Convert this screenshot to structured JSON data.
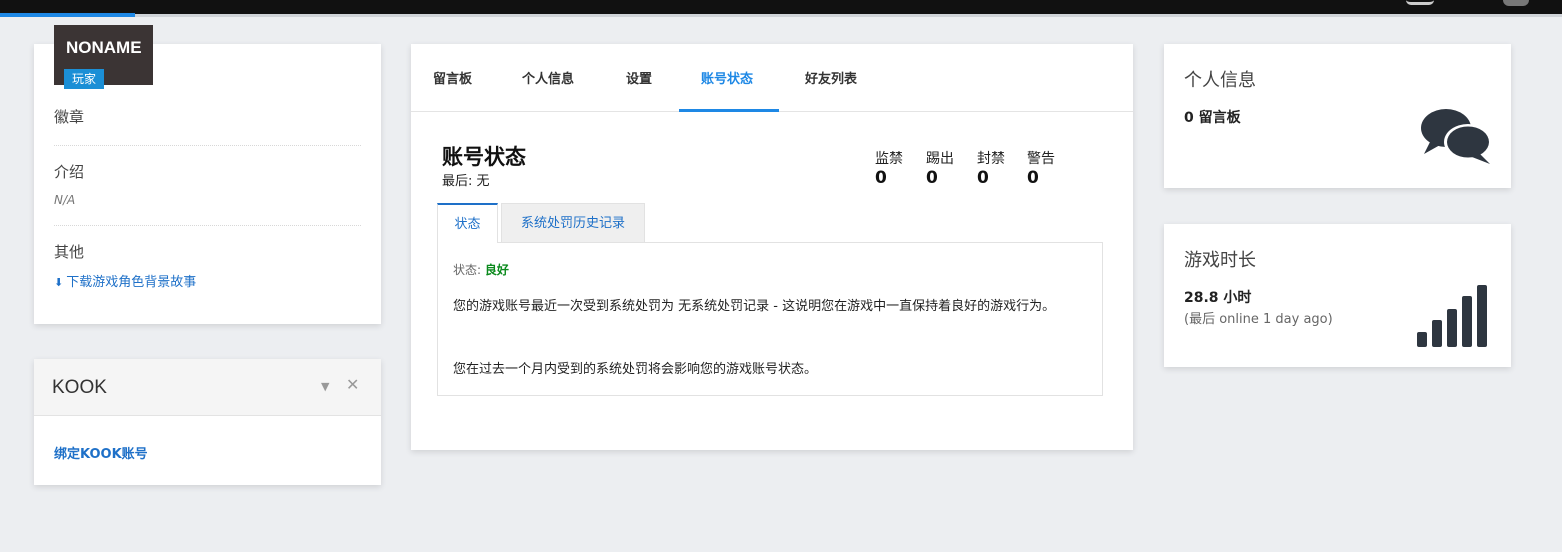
{
  "profile": {
    "name": "NONAME",
    "role": "玩家",
    "badges_label": "徽章",
    "intro_label": "介绍",
    "intro_value": "N/A",
    "other_label": "其他",
    "download_link": "下载游戏角色背景故事"
  },
  "kook": {
    "title": "KOOK",
    "bind_link": "绑定KOOK账号"
  },
  "nav": {
    "tabs": [
      "留言板",
      "个人信息",
      "设置",
      "账号状态",
      "好友列表"
    ],
    "active": "账号状态"
  },
  "account": {
    "title": "账号状态",
    "last": "最后: 无",
    "stats": [
      {
        "label": "监禁",
        "value": "0"
      },
      {
        "label": "踢出",
        "value": "0"
      },
      {
        "label": "封禁",
        "value": "0"
      },
      {
        "label": "警告",
        "value": "0"
      }
    ],
    "subtabs": [
      "状态",
      "系统处罚历史记录"
    ],
    "status_label": "状态:",
    "status_value": "良好",
    "paragraph1": "您的游戏账号最近一次受到系统处罚为 无系统处罚记录 - 这说明您在游戏中一直保持着良好的游戏行为。",
    "paragraph2": "您在过去一个月内受到的系统处罚将会影响您的游戏账号状态。"
  },
  "right": {
    "info_title": "个人信息",
    "info_value": "0 留言板",
    "info_icon": "comments-icon",
    "time_title": "游戏时长",
    "time_value": "28.8 小时",
    "time_sub": "(最后 online 1 day ago)",
    "time_icon": "signal-bars-icon"
  },
  "colors": {
    "accent": "#1e88e5",
    "link": "#1e70c8",
    "good": "#0b8a1d",
    "badge": "#1b8fd6",
    "avatar_bg": "#3b3434"
  }
}
